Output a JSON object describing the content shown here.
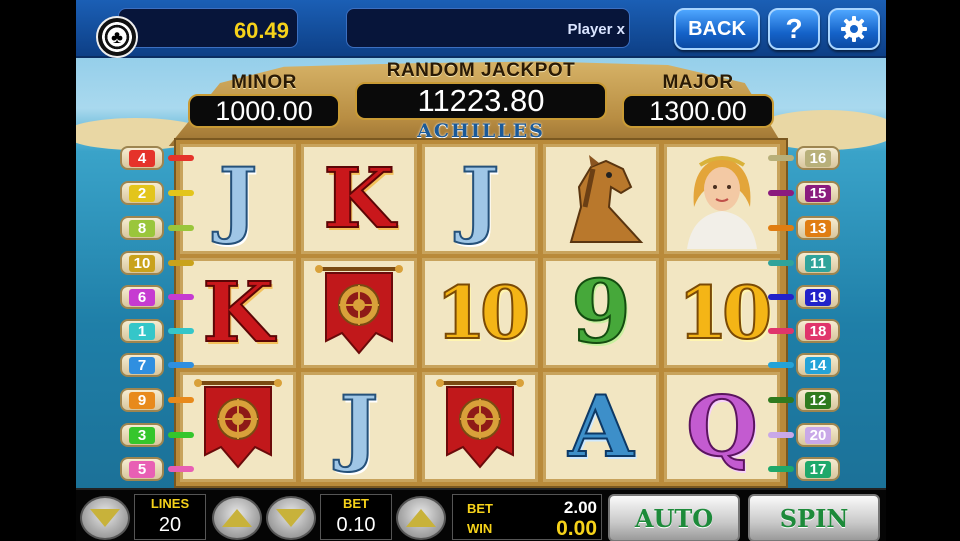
{
  "header": {
    "balance": "60.49",
    "player_name": "Player x",
    "back_label": "BACK",
    "help_label": "?"
  },
  "jackpots": {
    "minor_label": "MINOR",
    "minor_value": "1000.00",
    "random_label": "RANDOM JACKPOT",
    "random_value": "11223.80",
    "major_label": "MAJOR",
    "major_value": "1300.00"
  },
  "game_title": "ACHILLES",
  "reels": [
    [
      "J",
      "K",
      "banner"
    ],
    [
      "K",
      "banner",
      "J"
    ],
    [
      "J",
      "10",
      "banner"
    ],
    [
      "horse",
      "9",
      "A"
    ],
    [
      "goddess",
      "10",
      "Q"
    ]
  ],
  "left_lines": [
    {
      "num": "4",
      "color": "#e5332a"
    },
    {
      "num": "2",
      "color": "#e3c51b"
    },
    {
      "num": "8",
      "color": "#9ac63b"
    },
    {
      "num": "10",
      "color": "#c9a21b"
    },
    {
      "num": "6",
      "color": "#c63bd1"
    },
    {
      "num": "1",
      "color": "#35c6c9"
    },
    {
      "num": "7",
      "color": "#2f8fe0"
    },
    {
      "num": "9",
      "color": "#e88a1c"
    },
    {
      "num": "3",
      "color": "#35c62c"
    },
    {
      "num": "5",
      "color": "#e85fb4"
    }
  ],
  "right_lines": [
    {
      "num": "16",
      "color": "#b8b07a"
    },
    {
      "num": "15",
      "color": "#8a1b7e"
    },
    {
      "num": "13",
      "color": "#e07d12"
    },
    {
      "num": "11",
      "color": "#2fa39b"
    },
    {
      "num": "19",
      "color": "#2222c9"
    },
    {
      "num": "18",
      "color": "#e0356b"
    },
    {
      "num": "14",
      "color": "#24a3d8"
    },
    {
      "num": "12",
      "color": "#2f7a1f"
    },
    {
      "num": "20",
      "color": "#c9a8e8"
    },
    {
      "num": "17",
      "color": "#1fa86a"
    }
  ],
  "bottom": {
    "lines_label": "LINES",
    "lines_value": "20",
    "bet_label": "BET",
    "bet_value": "0.10",
    "totalbet_label": "BET",
    "totalbet_value": "2.00",
    "win_label": "WIN",
    "win_value": "0.00",
    "auto_label": "AUTO",
    "spin_label": "SPIN"
  },
  "colors": {
    "accent_yellow": "#f6d21a",
    "button_blue": "#1563c9",
    "spin_text": "#1d8a3a"
  }
}
